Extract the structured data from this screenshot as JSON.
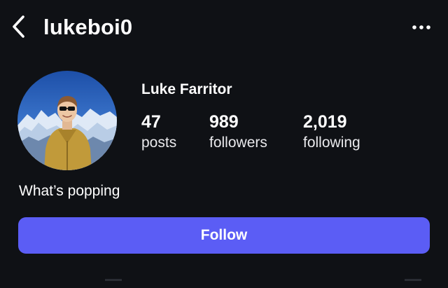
{
  "header": {
    "username": "lukeboi0",
    "back_icon": "chevron-left-icon",
    "more_icon": "more-horizontal-icon"
  },
  "profile": {
    "display_name": "Luke Farritor",
    "avatar_alt": "profile photo",
    "bio": "What’s popping"
  },
  "stats": [
    {
      "value": "47",
      "label": "posts"
    },
    {
      "value": "989",
      "label": "followers"
    },
    {
      "value": "2,019",
      "label": "following"
    }
  ],
  "actions": {
    "follow_label": "Follow"
  },
  "colors": {
    "background": "#0f1115",
    "accent": "#5b5df5",
    "text": "#ffffff"
  }
}
